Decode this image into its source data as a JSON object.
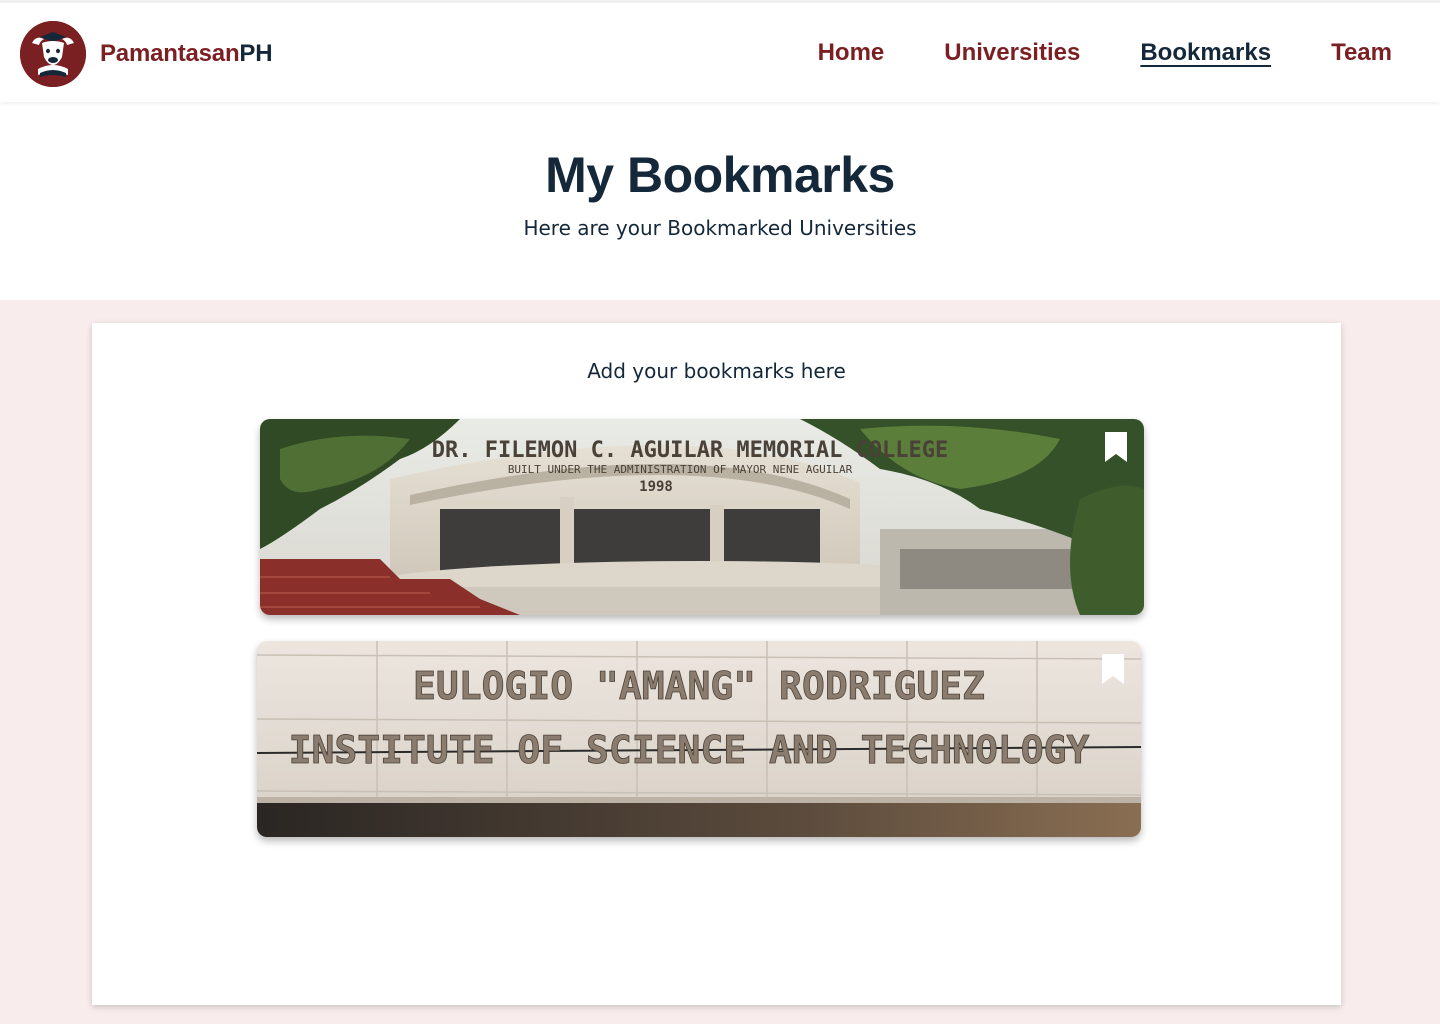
{
  "brand": {
    "name_part1": "Pamantasan",
    "name_part2": "PH",
    "logo_icon": "carabao-graduate-logo-icon"
  },
  "nav": {
    "items": [
      {
        "label": "Home",
        "active": false
      },
      {
        "label": "Universities",
        "active": false
      },
      {
        "label": "Bookmarks",
        "active": true
      },
      {
        "label": "Team",
        "active": false
      }
    ]
  },
  "header": {
    "title": "My Bookmarks",
    "subtitle": "Here are your Bookmarked Universities"
  },
  "bookmarks_panel": {
    "heading": "Add your bookmarks here",
    "cards": [
      {
        "sign_line1": "DR. FILEMON C. AGUILAR MEMORIAL COLLEGE",
        "sign_line2": "BUILT UNDER THE ADMINISTRATION OF MAYOR NENE AGUILAR",
        "sign_year": "1998",
        "bookmark_icon": "bookmark-filled-icon"
      },
      {
        "sign_line1": "EULOGIO \"AMANG\" RODRIGUEZ",
        "sign_line2": "INSTITUTE OF SCIENCE AND TECHNOLOGY",
        "bookmark_icon": "bookmark-filled-icon"
      }
    ]
  },
  "colors": {
    "brand_maroon": "#7a1f22",
    "navy": "#14283a",
    "pink_background": "#f8ecec"
  }
}
